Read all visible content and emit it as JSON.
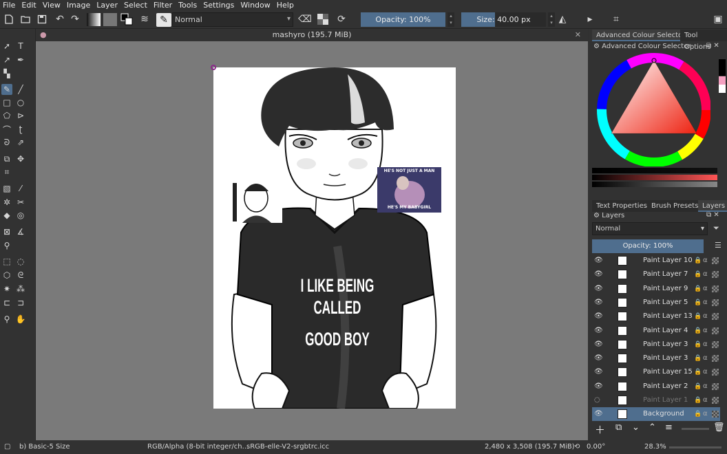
{
  "menu": [
    "File",
    "Edit",
    "View",
    "Image",
    "Layer",
    "Select",
    "Filter",
    "Tools",
    "Settings",
    "Window",
    "Help"
  ],
  "toolbar": {
    "blend_mode": "Normal",
    "opacity_label": "Opacity: 100%",
    "size_label": "Size: 40.00 px",
    "size_fraction": 0.4
  },
  "document": {
    "title": "mashyro (195.7 MiB)",
    "shirt_text_line1": "I LIKE BEING CALLED",
    "shirt_text_line2": "GOOD BOY",
    "meme_text_top": "HE'S NOT JUST A MAN",
    "meme_text_bottom": "HE'S MY BABYGIRL"
  },
  "dock": {
    "tab_color_selector": "Advanced Colour Selector",
    "tab_tool_options": "Tool Options",
    "color_panel_title": "Advanced Colour Selector",
    "tab_text_properties": "Text Properties",
    "tab_brush_presets": "Brush Presets",
    "tab_layers": "Layers",
    "layers_title": "Layers",
    "layers_blend": "Normal",
    "layers_opacity": "Opacity: 100%"
  },
  "layers": [
    {
      "name": "Paint Layer 10",
      "visible": true,
      "selected": false,
      "dim": false
    },
    {
      "name": "Paint Layer 7",
      "visible": true,
      "selected": false,
      "dim": false
    },
    {
      "name": "Paint Layer 9",
      "visible": true,
      "selected": false,
      "dim": false
    },
    {
      "name": "Paint Layer 5",
      "visible": true,
      "selected": false,
      "dim": false
    },
    {
      "name": "Paint Layer 13",
      "visible": true,
      "selected": false,
      "dim": false
    },
    {
      "name": "Paint Layer 4",
      "visible": true,
      "selected": false,
      "dim": false
    },
    {
      "name": "Paint Layer 3",
      "visible": true,
      "selected": false,
      "dim": false
    },
    {
      "name": "Paint Layer 3",
      "visible": true,
      "selected": false,
      "dim": false
    },
    {
      "name": "Paint Layer 15",
      "visible": true,
      "selected": false,
      "dim": false
    },
    {
      "name": "Paint Layer 2",
      "visible": true,
      "selected": false,
      "dim": false
    },
    {
      "name": "Paint Layer 1",
      "visible": false,
      "selected": false,
      "dim": true
    },
    {
      "name": "Background",
      "visible": true,
      "selected": true,
      "dim": false
    }
  ],
  "status": {
    "brush": "b) Basic-5 Size",
    "color_model": "RGB/Alpha (8-bit integer/ch...",
    "profile": "sRGB-elle-V2-srgbtrc.icc",
    "dimensions": "2,480 x 3,508 (195.7 MiB)",
    "rotation": "0.00°",
    "zoom": "28.3%"
  },
  "colors": {
    "accent": "#4f6e8e",
    "panel": "#323232",
    "canvas_bg": "#7a7a7a"
  }
}
